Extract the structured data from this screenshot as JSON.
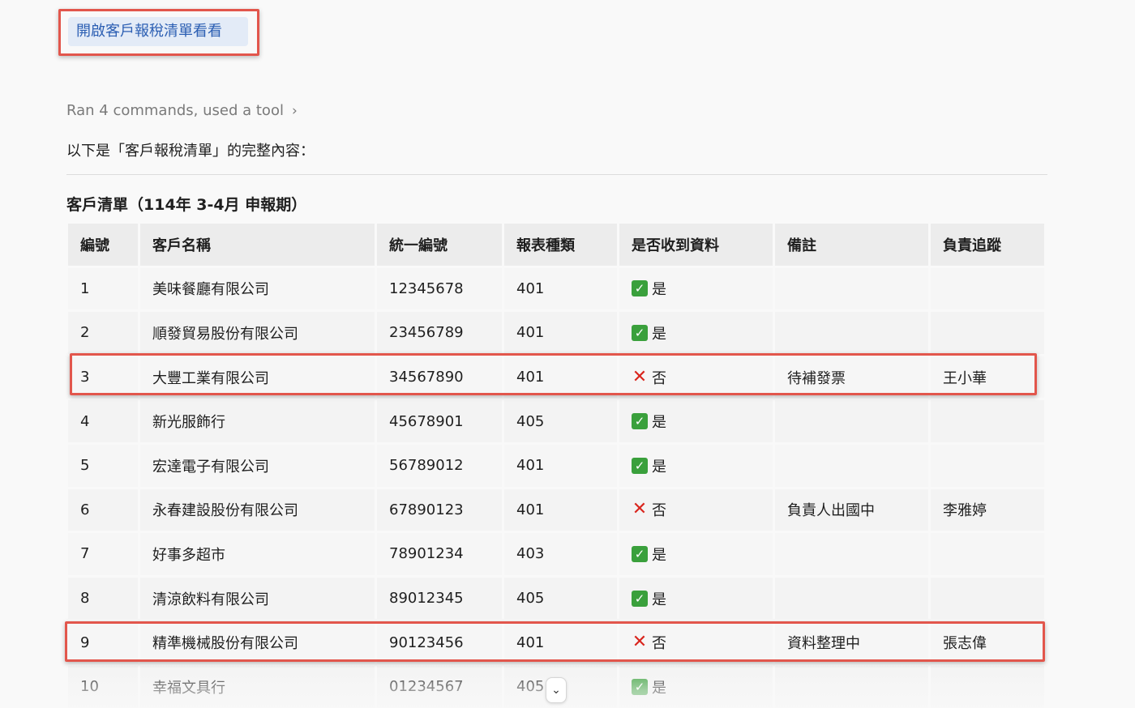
{
  "action_button": {
    "label": "開啟客戶報稅清單看看"
  },
  "activity": {
    "summary": "Ran 4 commands, used a tool",
    "chevron": "›"
  },
  "intro_text": "以下是「客戶報稅清單」的完整內容：",
  "section_title": "客戶清單（114年 3-4月 申報期）",
  "table": {
    "headers": [
      "編號",
      "客戶名稱",
      "統一編號",
      "報表種類",
      "是否收到資料",
      "備註",
      "負責追蹤"
    ],
    "rows": [
      {
        "no": "1",
        "name": "美味餐廳有限公司",
        "tax_id": "12345678",
        "form": "401",
        "received": true,
        "received_label": "是",
        "note": "",
        "owner": ""
      },
      {
        "no": "2",
        "name": "順發貿易股份有限公司",
        "tax_id": "23456789",
        "form": "401",
        "received": true,
        "received_label": "是",
        "note": "",
        "owner": ""
      },
      {
        "no": "3",
        "name": "大豐工業有限公司",
        "tax_id": "34567890",
        "form": "401",
        "received": false,
        "received_label": "否",
        "note": "待補發票",
        "owner": "王小華"
      },
      {
        "no": "4",
        "name": "新光服飾行",
        "tax_id": "45678901",
        "form": "405",
        "received": true,
        "received_label": "是",
        "note": "",
        "owner": ""
      },
      {
        "no": "5",
        "name": "宏達電子有限公司",
        "tax_id": "56789012",
        "form": "401",
        "received": true,
        "received_label": "是",
        "note": "",
        "owner": ""
      },
      {
        "no": "6",
        "name": "永春建設股份有限公司",
        "tax_id": "67890123",
        "form": "401",
        "received": false,
        "received_label": "否",
        "note": "負責人出國中",
        "owner": "李雅婷"
      },
      {
        "no": "7",
        "name": "好事多超市",
        "tax_id": "78901234",
        "form": "403",
        "received": true,
        "received_label": "是",
        "note": "",
        "owner": ""
      },
      {
        "no": "8",
        "name": "清涼飲料有限公司",
        "tax_id": "89012345",
        "form": "405",
        "received": true,
        "received_label": "是",
        "note": "",
        "owner": ""
      },
      {
        "no": "9",
        "name": "精準機械股份有限公司",
        "tax_id": "90123456",
        "form": "401",
        "received": false,
        "received_label": "否",
        "note": "資料整理中",
        "owner": "張志偉"
      },
      {
        "no": "10",
        "name": "幸福文具行",
        "tax_id": "01234567",
        "form": "405",
        "received": true,
        "received_label": "是",
        "note": "",
        "owner": ""
      }
    ]
  },
  "marks": {
    "yes_icon": "check-box-icon",
    "no_icon": "cross-icon",
    "yes_glyph": "✓",
    "no_glyph": "✕"
  },
  "colors": {
    "highlight": "#e2564c",
    "check": "#3aa03c",
    "cross": "#d9251d",
    "link": "#2c5fb3"
  },
  "scroll_button": {
    "glyph": "⌄"
  }
}
